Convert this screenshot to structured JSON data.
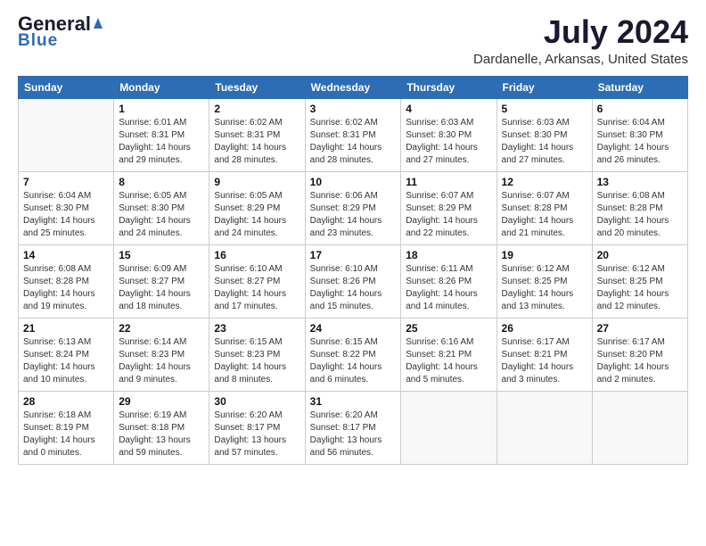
{
  "header": {
    "logo_line1": "General",
    "logo_line2": "Blue",
    "month": "July 2024",
    "location": "Dardanelle, Arkansas, United States"
  },
  "weekdays": [
    "Sunday",
    "Monday",
    "Tuesday",
    "Wednesday",
    "Thursday",
    "Friday",
    "Saturday"
  ],
  "rows": [
    [
      {
        "day": "",
        "info": ""
      },
      {
        "day": "1",
        "info": "Sunrise: 6:01 AM\nSunset: 8:31 PM\nDaylight: 14 hours\nand 29 minutes."
      },
      {
        "day": "2",
        "info": "Sunrise: 6:02 AM\nSunset: 8:31 PM\nDaylight: 14 hours\nand 28 minutes."
      },
      {
        "day": "3",
        "info": "Sunrise: 6:02 AM\nSunset: 8:31 PM\nDaylight: 14 hours\nand 28 minutes."
      },
      {
        "day": "4",
        "info": "Sunrise: 6:03 AM\nSunset: 8:30 PM\nDaylight: 14 hours\nand 27 minutes."
      },
      {
        "day": "5",
        "info": "Sunrise: 6:03 AM\nSunset: 8:30 PM\nDaylight: 14 hours\nand 27 minutes."
      },
      {
        "day": "6",
        "info": "Sunrise: 6:04 AM\nSunset: 8:30 PM\nDaylight: 14 hours\nand 26 minutes."
      }
    ],
    [
      {
        "day": "7",
        "info": "Sunrise: 6:04 AM\nSunset: 8:30 PM\nDaylight: 14 hours\nand 25 minutes."
      },
      {
        "day": "8",
        "info": "Sunrise: 6:05 AM\nSunset: 8:30 PM\nDaylight: 14 hours\nand 24 minutes."
      },
      {
        "day": "9",
        "info": "Sunrise: 6:05 AM\nSunset: 8:29 PM\nDaylight: 14 hours\nand 24 minutes."
      },
      {
        "day": "10",
        "info": "Sunrise: 6:06 AM\nSunset: 8:29 PM\nDaylight: 14 hours\nand 23 minutes."
      },
      {
        "day": "11",
        "info": "Sunrise: 6:07 AM\nSunset: 8:29 PM\nDaylight: 14 hours\nand 22 minutes."
      },
      {
        "day": "12",
        "info": "Sunrise: 6:07 AM\nSunset: 8:28 PM\nDaylight: 14 hours\nand 21 minutes."
      },
      {
        "day": "13",
        "info": "Sunrise: 6:08 AM\nSunset: 8:28 PM\nDaylight: 14 hours\nand 20 minutes."
      }
    ],
    [
      {
        "day": "14",
        "info": "Sunrise: 6:08 AM\nSunset: 8:28 PM\nDaylight: 14 hours\nand 19 minutes."
      },
      {
        "day": "15",
        "info": "Sunrise: 6:09 AM\nSunset: 8:27 PM\nDaylight: 14 hours\nand 18 minutes."
      },
      {
        "day": "16",
        "info": "Sunrise: 6:10 AM\nSunset: 8:27 PM\nDaylight: 14 hours\nand 17 minutes."
      },
      {
        "day": "17",
        "info": "Sunrise: 6:10 AM\nSunset: 8:26 PM\nDaylight: 14 hours\nand 15 minutes."
      },
      {
        "day": "18",
        "info": "Sunrise: 6:11 AM\nSunset: 8:26 PM\nDaylight: 14 hours\nand 14 minutes."
      },
      {
        "day": "19",
        "info": "Sunrise: 6:12 AM\nSunset: 8:25 PM\nDaylight: 14 hours\nand 13 minutes."
      },
      {
        "day": "20",
        "info": "Sunrise: 6:12 AM\nSunset: 8:25 PM\nDaylight: 14 hours\nand 12 minutes."
      }
    ],
    [
      {
        "day": "21",
        "info": "Sunrise: 6:13 AM\nSunset: 8:24 PM\nDaylight: 14 hours\nand 10 minutes."
      },
      {
        "day": "22",
        "info": "Sunrise: 6:14 AM\nSunset: 8:23 PM\nDaylight: 14 hours\nand 9 minutes."
      },
      {
        "day": "23",
        "info": "Sunrise: 6:15 AM\nSunset: 8:23 PM\nDaylight: 14 hours\nand 8 minutes."
      },
      {
        "day": "24",
        "info": "Sunrise: 6:15 AM\nSunset: 8:22 PM\nDaylight: 14 hours\nand 6 minutes."
      },
      {
        "day": "25",
        "info": "Sunrise: 6:16 AM\nSunset: 8:21 PM\nDaylight: 14 hours\nand 5 minutes."
      },
      {
        "day": "26",
        "info": "Sunrise: 6:17 AM\nSunset: 8:21 PM\nDaylight: 14 hours\nand 3 minutes."
      },
      {
        "day": "27",
        "info": "Sunrise: 6:17 AM\nSunset: 8:20 PM\nDaylight: 14 hours\nand 2 minutes."
      }
    ],
    [
      {
        "day": "28",
        "info": "Sunrise: 6:18 AM\nSunset: 8:19 PM\nDaylight: 14 hours\nand 0 minutes."
      },
      {
        "day": "29",
        "info": "Sunrise: 6:19 AM\nSunset: 8:18 PM\nDaylight: 13 hours\nand 59 minutes."
      },
      {
        "day": "30",
        "info": "Sunrise: 6:20 AM\nSunset: 8:17 PM\nDaylight: 13 hours\nand 57 minutes."
      },
      {
        "day": "31",
        "info": "Sunrise: 6:20 AM\nSunset: 8:17 PM\nDaylight: 13 hours\nand 56 minutes."
      },
      {
        "day": "",
        "info": ""
      },
      {
        "day": "",
        "info": ""
      },
      {
        "day": "",
        "info": ""
      }
    ]
  ]
}
